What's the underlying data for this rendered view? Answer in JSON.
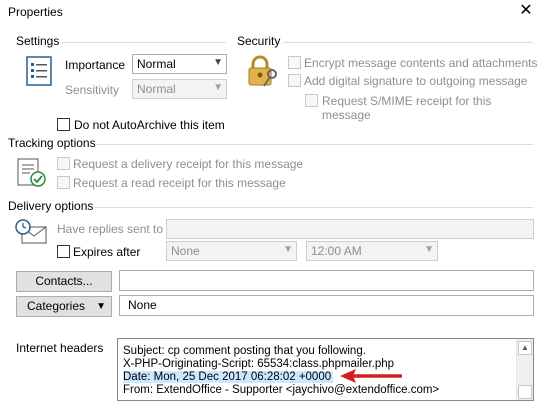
{
  "window": {
    "title": "Properties"
  },
  "settings": {
    "label": "Settings",
    "importance_label": "Importance",
    "importance_value": "Normal",
    "sensitivity_label": "Sensitivity",
    "sensitivity_value": "Normal",
    "autoarchive_label": "Do not AutoArchive this item"
  },
  "security": {
    "label": "Security",
    "encrypt_label": "Encrypt message contents and attachments",
    "signature_label": "Add digital signature to outgoing message",
    "smime_label": "Request S/MIME receipt for this message"
  },
  "tracking": {
    "label": "Tracking options",
    "delivery_receipt_label": "Request a delivery receipt for this message",
    "read_receipt_label": "Request a read receipt for this message"
  },
  "delivery": {
    "label": "Delivery options",
    "replies_label": "Have replies sent to",
    "expires_label": "Expires after",
    "expires_date": "None",
    "expires_time": "12:00 AM"
  },
  "contacts": {
    "button_label": "Contacts..."
  },
  "categories": {
    "button_label": "Categories",
    "value": "None"
  },
  "headers": {
    "label": "Internet headers",
    "lines": [
      "Subject: cp comment posting that you following.",
      "X-PHP-Originating-Script: 65534:class.phpmailer.php",
      "Date: Mon, 25 Dec 2017 06:28:02 +0000",
      "From: ExtendOffice - Supporter <jaychivo@extendoffice.com>"
    ]
  },
  "annotation": {
    "arrow_color": "#d42020"
  }
}
